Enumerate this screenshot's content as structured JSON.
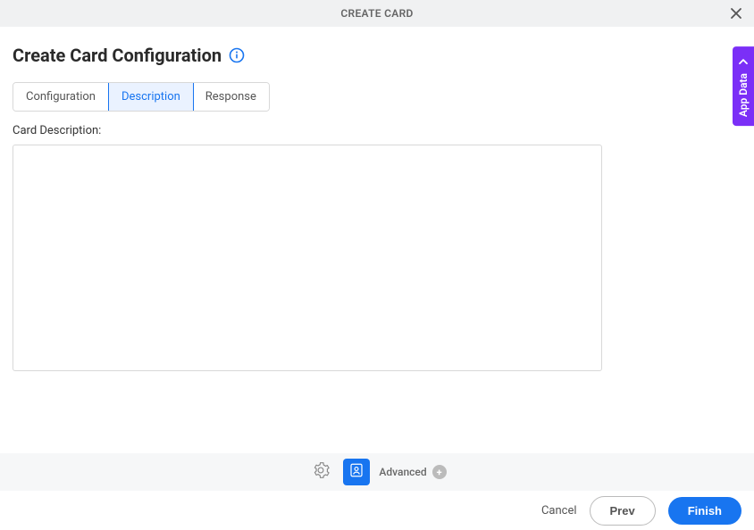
{
  "header": {
    "title": "CREATE CARD"
  },
  "page": {
    "title": "Create Card Configuration"
  },
  "tabs": {
    "configuration": "Configuration",
    "description": "Description",
    "response": "Response"
  },
  "form": {
    "description_label": "Card Description:",
    "description_value": ""
  },
  "sidepanel": {
    "label": "App Data"
  },
  "toolbar": {
    "advanced_label": "Advanced"
  },
  "footer": {
    "cancel": "Cancel",
    "prev": "Prev",
    "finish": "Finish"
  }
}
